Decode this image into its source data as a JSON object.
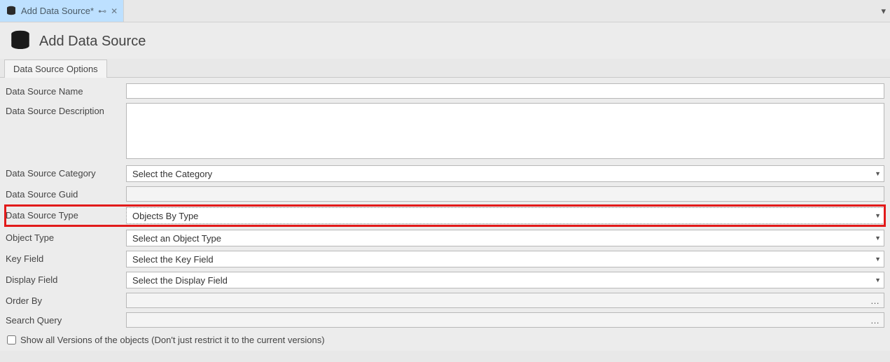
{
  "tab": {
    "title": "Add Data Source*"
  },
  "page": {
    "title": "Add Data Source"
  },
  "optionsTab": {
    "label": "Data Source Options"
  },
  "fields": {
    "name": {
      "label": "Data Source Name",
      "value": ""
    },
    "description": {
      "label": "Data Source Description",
      "value": ""
    },
    "category": {
      "label": "Data Source Category",
      "selected": "Select the Category"
    },
    "guid": {
      "label": "Data Source Guid",
      "value": ""
    },
    "type": {
      "label": "Data Source Type",
      "selected": "Objects By Type"
    },
    "objectType": {
      "label": "Object Type",
      "selected": "Select an Object Type"
    },
    "keyField": {
      "label": "Key Field",
      "selected": "Select the Key Field"
    },
    "displayField": {
      "label": "Display Field",
      "selected": "Select the Display Field"
    },
    "orderBy": {
      "label": "Order By",
      "ellipsis": "…"
    },
    "searchQuery": {
      "label": "Search Query",
      "ellipsis": "…"
    }
  },
  "checkbox": {
    "label": "Show all Versions of the objects (Don't just restrict it to the current versions)"
  }
}
